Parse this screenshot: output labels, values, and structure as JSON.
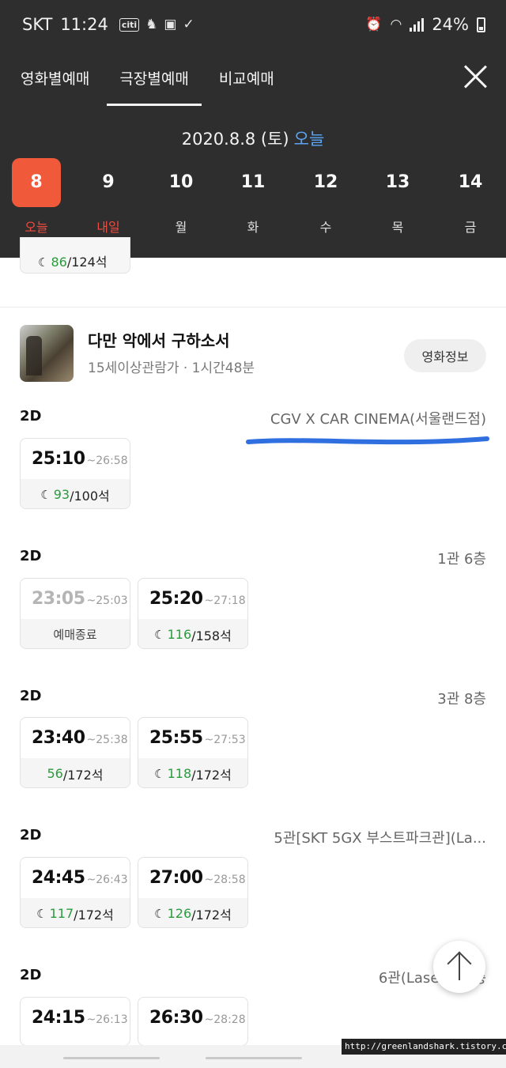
{
  "status_bar": {
    "carrier": "SKT",
    "time": "11:24",
    "battery": "24%",
    "citi_label": "citi"
  },
  "tabs": [
    {
      "label": "영화별예매",
      "active": false
    },
    {
      "label": "극장별예매",
      "active": true
    },
    {
      "label": "비교예매",
      "active": false
    }
  ],
  "date_header": {
    "date": "2020.8.8 (토)",
    "today": "오늘"
  },
  "days": [
    {
      "num": "8",
      "label": "오늘"
    },
    {
      "num": "9",
      "label": "내일"
    },
    {
      "num": "10",
      "label": "월"
    },
    {
      "num": "11",
      "label": "화"
    },
    {
      "num": "12",
      "label": "수"
    },
    {
      "num": "13",
      "label": "목"
    },
    {
      "num": "14",
      "label": "금"
    }
  ],
  "partial_card": {
    "available": "86",
    "total": "/124석"
  },
  "movie": {
    "title": "다만 악에서 구하소서",
    "meta": "15세이상관람가 · 1시간48분",
    "info_button": "영화정보"
  },
  "screenings": [
    {
      "format": "2D",
      "hall": "CGV X CAR CINEMA(서울랜드점)",
      "shows": [
        {
          "start": "25:10",
          "end": "~26:58",
          "available": "93",
          "total": "/100석"
        }
      ]
    },
    {
      "format": "2D",
      "hall": "1관 6층",
      "shows": [
        {
          "start": "23:05",
          "end": "~25:03",
          "status": "예매종료"
        },
        {
          "start": "25:20",
          "end": "~27:18",
          "available": "116",
          "total": "/158석"
        }
      ]
    },
    {
      "format": "2D",
      "hall": "3관 8층",
      "shows": [
        {
          "start": "23:40",
          "end": "~25:38",
          "available": "56",
          "total": "/172석"
        },
        {
          "start": "25:55",
          "end": "~27:53",
          "available": "118",
          "total": "/172석"
        }
      ]
    },
    {
      "format": "2D",
      "hall": "5관[SKT 5GX 부스트파크관](La...",
      "shows": [
        {
          "start": "24:45",
          "end": "~26:43",
          "available": "117",
          "total": "/172석"
        },
        {
          "start": "27:00",
          "end": "~28:58",
          "available": "126",
          "total": "/172석"
        }
      ]
    },
    {
      "format": "2D",
      "hall": "6관(Laser) 10층",
      "shows": [
        {
          "start": "24:15",
          "end": "~26:13",
          "available": "",
          "total": ""
        },
        {
          "start": "26:30",
          "end": "~28:28",
          "available": "",
          "total": ""
        }
      ]
    }
  ],
  "watermark": "http://greenlandshark.tistory.com",
  "colors": {
    "header_bg": "#2e2e2e",
    "selected_day": "#f05a3a",
    "today_link": "#5aa6f5",
    "seat_green": "#2a9b3c",
    "highlight_blue": "#2f6fe0"
  }
}
